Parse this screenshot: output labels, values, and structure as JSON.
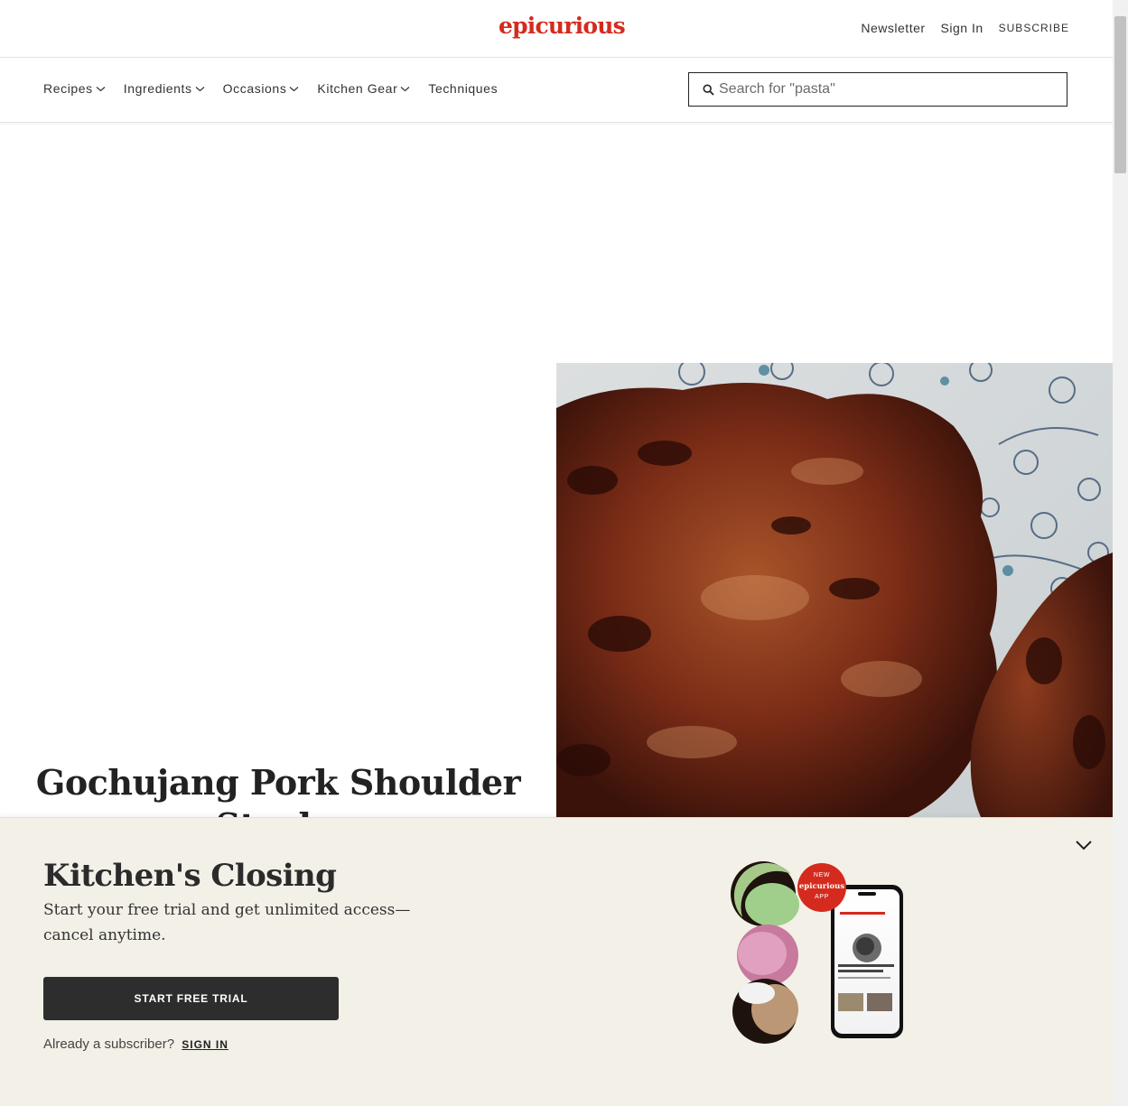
{
  "brand": {
    "logo_text": "epicurious",
    "accent_color": "#d42b1e"
  },
  "header": {
    "newsletter": "Newsletter",
    "sign_in": "Sign In",
    "subscribe": "SUBSCRIBE"
  },
  "nav": {
    "items": [
      {
        "label": "Recipes",
        "dropdown": true
      },
      {
        "label": "Ingredients",
        "dropdown": true
      },
      {
        "label": "Occasions",
        "dropdown": true
      },
      {
        "label": "Kitchen Gear",
        "dropdown": true
      },
      {
        "label": "Techniques",
        "dropdown": false
      }
    ],
    "search": {
      "placeholder": "Search for \"pasta\"",
      "value": "",
      "icon": "search-icon"
    }
  },
  "recipe": {
    "title": "Gochujang Pork Shoulder Steaks",
    "image_alt": "Glazed gochujang pork shoulder steaks on a patterned plate"
  },
  "paywall": {
    "title": "Kitchen's Closing",
    "subtitle": "Start your free trial and get unlimited access—cancel anytime.",
    "cta": "START FREE TRIAL",
    "already": "Already a subscriber?",
    "sign_in": "SIGN IN",
    "badge_new": "NEW",
    "badge_brand": "epicurious",
    "badge_app": "APP",
    "close_icon": "chevron-down-icon",
    "background": "#f3f0e8"
  }
}
